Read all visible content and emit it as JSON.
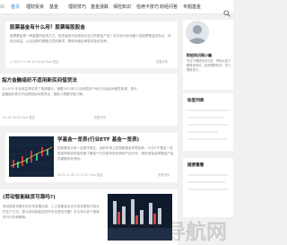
{
  "nav": {
    "logo": "综",
    "items": [
      {
        "label": "首页",
        "active": true
      },
      {
        "label": "理财投资",
        "active": false
      },
      {
        "label": "基金",
        "active": false
      },
      {
        "label": "理财技巧",
        "active": false
      },
      {
        "label": "基金涨跌",
        "active": false
      },
      {
        "label": "保险知识",
        "active": false
      },
      {
        "label": "信用卡技巧",
        "active": false
      },
      {
        "label": "财经问答",
        "active": false
      },
      {
        "label": "专题基金",
        "active": false
      }
    ],
    "search_icon": "search-icon"
  },
  "posts": [
    {
      "title": "股票基金有什么用？股票每股股金",
      "summary": "股票基金是一种重要的投资方式，投资者如何选择适合自己的基金产品？本文将为你详细介绍股票基金的特点、风险与收益，以及选购时需要注意的事项，帮助你做出明智的投资决策。",
      "date": "2023-12-08 15:39:40",
      "views": "Post",
      "tag": "基金",
      "more": "查看详情"
    },
    {
      "title": "指方金融组织不适用新民间借贷法",
      "summary": "12.45% 年化收益率实现了稳健增长，随着2023年12月我国多个地方出台民间借贷新规，部分金融组织依法不适用新民间借贷法，借款人需要仔细了解。",
      "date": "-12-08 40:00",
      "views": "Post",
      "tag": "基金",
      "more": "查看详情"
    },
    {
      "title": "学基金一览表(行业ETF 基金一览表)",
      "summary": "指数基金大家一定都不陌生，目前市场上的指数基金有很多种，行业ETF基金一览表能帮助投资者快速了解各个行业板块的走势和产品分布，是投资者选择基金产品的重要参考资料。",
      "date": "2023-12-08 15:32:01",
      "views": "Post",
      "tag": "基金",
      "more": "查看详情"
    },
    {
      "title": "(劳动智能缺货可靠吗?)",
      "summary": "劳动智能设备在近年来发展迅速，人工智能技术正在改变着各行各业的生产方式，那么劳动智能缺货的说法是否可靠？本文将从多个角度进行分析和解读。",
      "date": "",
      "views": "",
      "tag": "",
      "more": ""
    }
  ],
  "sidebar": {
    "author_name": "财经知识网小编",
    "author_desc": "专注于理财知识分享，帮助大家了解财经资讯，投资理财知识、学习理财技巧。",
    "section1": "标签列表",
    "section2": "随便看看"
  },
  "watermark": "0401导航网",
  "colors": {
    "accent": "#1e88e5",
    "thumb_bg": "#16243a"
  }
}
